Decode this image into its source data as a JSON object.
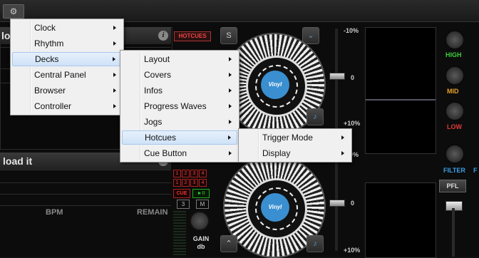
{
  "app": {
    "gear_glyph": "⚙",
    "deck_top": {
      "loaded_text": "lo",
      "hotcues_label": "HOTCUES"
    },
    "deck_bottom": {
      "load_prompt": "load it",
      "bpm_label": "BPM",
      "remain_label": "REMAIN"
    },
    "cue_numbers": [
      "1",
      "2",
      "3",
      "4",
      "1",
      "2",
      "3",
      "4"
    ],
    "cue_label": "CUE",
    "play_label": "►II",
    "page_3": "3",
    "mode_m": "M",
    "gain_label_1": "GAIN",
    "gain_label_2": "db",
    "deck_button_s": "S",
    "deck_button_down": "⌄",
    "deck_button_up": "⌃",
    "note_glyph": "♪",
    "vinyl_label": "Vinyl",
    "pitch": {
      "top_minus": "-10%",
      "zero": "0",
      "plus": "+10%",
      "bottom_plus": "+10%",
      "mid_minus": "-10%"
    },
    "eq": {
      "high": "HIGH",
      "mid": "MID",
      "low": "LOW",
      "filter": "FILTER",
      "f": "F"
    },
    "pfl_label": "PFL",
    "colors": {
      "high": "#3ecf3e",
      "mid": "#e6a22a",
      "low": "#e23a3a",
      "filter": "#3a9fe6",
      "menu_bg": "#f0f0f0",
      "highlight": "#cfe2f7"
    }
  },
  "menus": {
    "main": [
      "Clock",
      "Rhythm",
      "Decks",
      "Central Panel",
      "Browser",
      "Controller"
    ],
    "decks": [
      "Layout",
      "Covers",
      "Infos",
      "Progress Waves",
      "Jogs",
      "Hotcues",
      "Cue Button"
    ],
    "hotcues": [
      "Trigger Mode",
      "Display"
    ],
    "highlighted": {
      "main": "Decks",
      "decks": "Hotcues"
    }
  }
}
